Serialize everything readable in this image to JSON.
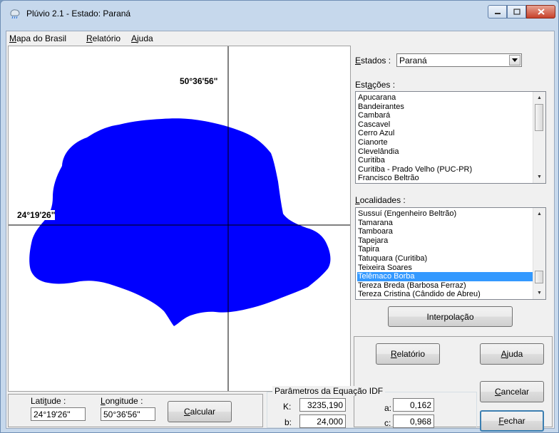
{
  "window": {
    "title": "Plúvio 2.1 - Estado: Paraná",
    "menu": [
      {
        "label": "Mapa do Brasil",
        "accel_first": "M",
        "rest": "apa do Brasil"
      },
      {
        "label": "Relatório",
        "accel_first": "R",
        "rest": "elatório"
      },
      {
        "label": "Ajuda",
        "accel_first": "A",
        "rest": "juda"
      }
    ]
  },
  "map": {
    "longitude_label": "50°36'56\"",
    "latitude_label": "24°19'26\"",
    "fill_color": "#0000ff"
  },
  "estados": {
    "label_accel": "E",
    "label_rest": "stados :",
    "selected": "Paraná"
  },
  "estacoes": {
    "label_pre": "Est",
    "label_accel": "a",
    "label_rest": "ções :",
    "items": [
      "Apucarana",
      "Bandeirantes",
      "Cambará",
      "Cascavel",
      "Cerro Azul",
      "Cianorte",
      "Clevelândia",
      "Curitiba",
      "Curitiba - Prado Velho (PUC-PR)",
      "Francisco Beltrão"
    ]
  },
  "localidades": {
    "label_accel": "L",
    "label_rest": "ocalidades :",
    "items": [
      "Sussuí (Engenheiro Beltrão)",
      "Tamarana",
      "Tamboara",
      "Tapejara",
      "Tapira",
      "Tatuquara (Curitiba)",
      "Teixeira Soares",
      "Telêmaco Borba",
      "Tereza Breda (Barbosa Ferraz)",
      "Tereza Cristina (Cândido de Abreu)"
    ],
    "selected_index": 7
  },
  "buttons": {
    "interpolacao": "Interpolação",
    "relatorio_accel": "R",
    "relatorio_rest": "elatório",
    "ajuda_accel": "A",
    "ajuda_rest": "juda",
    "cancelar_accel": "C",
    "cancelar_rest": "ancelar",
    "fechar_accel": "F",
    "fechar_rest": "echar",
    "calcular_accel": "C",
    "calcular_rest": "alcular"
  },
  "coords": {
    "latitude_label_pre": "Lati",
    "latitude_label_accel": "t",
    "latitude_label_rest": "ude :",
    "latitude_value": "24°19'26''",
    "longitude_label_accel": "L",
    "longitude_label_rest": "ongitude :",
    "longitude_value": "50°36'56''"
  },
  "idf": {
    "title": "Parâmetros da Equação IDF",
    "k_label": "K:",
    "k_value": "3235,190",
    "b_label": "b:",
    "b_value": "24,000",
    "a_label": "a:",
    "a_value": "0,162",
    "c_label": "c:",
    "c_value": "0,968"
  }
}
